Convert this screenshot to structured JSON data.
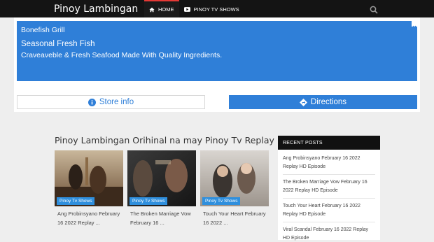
{
  "header": {
    "site_title": "Pinoy Lambingan",
    "nav": [
      {
        "label": "HOME",
        "icon": "home-icon",
        "active": true
      },
      {
        "label": "PINOY TV SHOWS",
        "icon": "youtube-icon",
        "active": false
      }
    ],
    "search_icon": "search-icon"
  },
  "ad": {
    "advertiser": "Bonefish Grill",
    "headline": "Seasonal Fresh Fish",
    "description": "Craveaveble & Fresh Seafood Made With Quality Ingredients.",
    "store_button": "Store info",
    "directions_button": "Directions",
    "accent_color": "#2f7fd8"
  },
  "main": {
    "section_title": "Pinoy Lambingan Orihinal na may Pinoy Tv Replay",
    "posts": [
      {
        "tag": "Pinoy Tv Shows",
        "title": "Ang Probinsyano February 16 2022 Replay ..."
      },
      {
        "tag": "Pinoy Tv Shows",
        "title": "The Broken Marriage Vow February 16 ..."
      },
      {
        "tag": "Pinoy Tv Shows",
        "title": "Touch Your Heart February 16 2022 ..."
      }
    ]
  },
  "sidebar": {
    "heading": "RECENT POSTS",
    "items": [
      "Ang Probinsyano February 16 2022 Replay HD Episode",
      "The Broken Marriage Vow February 16 2022 Replay HD Episode",
      "Touch Your Heart February 16 2022 Replay HD Episode",
      "Viral Scandal February 16 2022 Replay HD Episode"
    ]
  }
}
